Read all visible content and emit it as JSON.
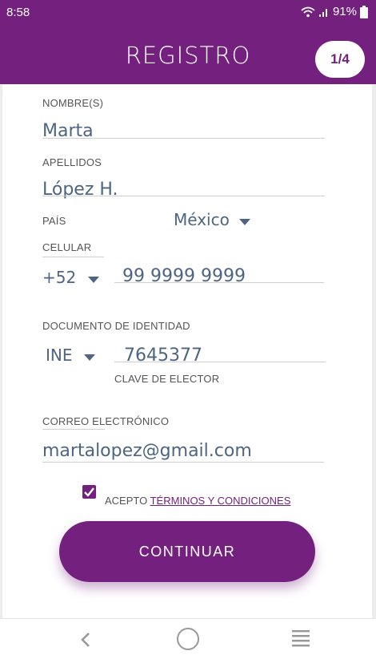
{
  "status": {
    "time": "8:58",
    "battery": "91%"
  },
  "header": {
    "title": "REGISTRO",
    "step": "1/4"
  },
  "form": {
    "nombre": {
      "label": "NOMBRE(S)",
      "value": "Marta"
    },
    "apellidos": {
      "label": "APELLIDOS",
      "value": "López H."
    },
    "pais": {
      "label": "PAÍS",
      "value": "México"
    },
    "celular": {
      "label": "CELULAR",
      "prefix": "+52",
      "value": "99 9999 9999"
    },
    "documento": {
      "label": "DOCUMENTO DE IDENTIDAD",
      "type": "INE",
      "value": "7645377",
      "sublabel": "CLAVE DE ELECTOR"
    },
    "correo": {
      "label": "CORREO ELECTRÓNICO",
      "value": "martalopez@gmail.com"
    }
  },
  "terms": {
    "prefix": "ACEPTO",
    "link": "TÉRMINOS Y CONDICIONES",
    "checked": true
  },
  "continue_label": "CONTINUAR",
  "colors": {
    "brand": "#74207f",
    "value_text": "#4d6582"
  }
}
